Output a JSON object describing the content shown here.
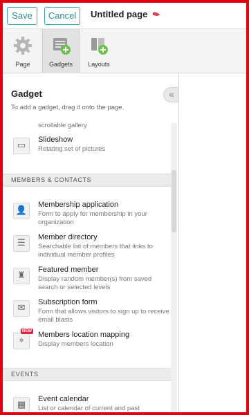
{
  "toolbar": {
    "save_label": "Save",
    "cancel_label": "Cancel",
    "page_title": "Untitled page",
    "edit_icon": "pencil-icon"
  },
  "modes": [
    {
      "label": "Page",
      "icon": "gear-icon",
      "active": false
    },
    {
      "label": "Gadgets",
      "icon": "add-gadget-icon",
      "active": true
    },
    {
      "label": "Layouts",
      "icon": "add-layout-icon",
      "active": false
    }
  ],
  "panel": {
    "title": "Gadget",
    "subtitle": "To add a gadget, drag it onto the page.",
    "collapse_glyph": "«",
    "partial_text": "scrollable gallery",
    "slideshow": {
      "name": "Slideshow",
      "desc": "Rotating set of pictures",
      "icon": "picture-icon"
    },
    "sections": [
      {
        "title": "MEMBERS & CONTACTS",
        "items": [
          {
            "name": "Membership application",
            "desc": "Form to apply for membership in your organization",
            "icon": "add-person-icon"
          },
          {
            "name": "Member directory",
            "desc": "Searchable list of members that links to individual member profiles",
            "icon": "list-icon"
          },
          {
            "name": "Featured member",
            "desc": "Display random member(s) from saved search or selected levels",
            "icon": "chess-piece-icon"
          },
          {
            "name": "Subscription form",
            "desc": "Form that allows visitors to sign up to receive email blasts",
            "icon": "envelope-icon"
          },
          {
            "name": "Members location mapping",
            "desc": "Display members location",
            "icon": "map-pin-icon",
            "badge": "NEW"
          }
        ]
      },
      {
        "title": "EVENTS",
        "items": [
          {
            "name": "Event calendar",
            "desc": "List or calendar of current and past",
            "icon": "calendar-icon"
          }
        ]
      }
    ]
  },
  "colors": {
    "accent": "#2a8f96",
    "frame": "#e3000f",
    "badge": "#d7263d"
  }
}
